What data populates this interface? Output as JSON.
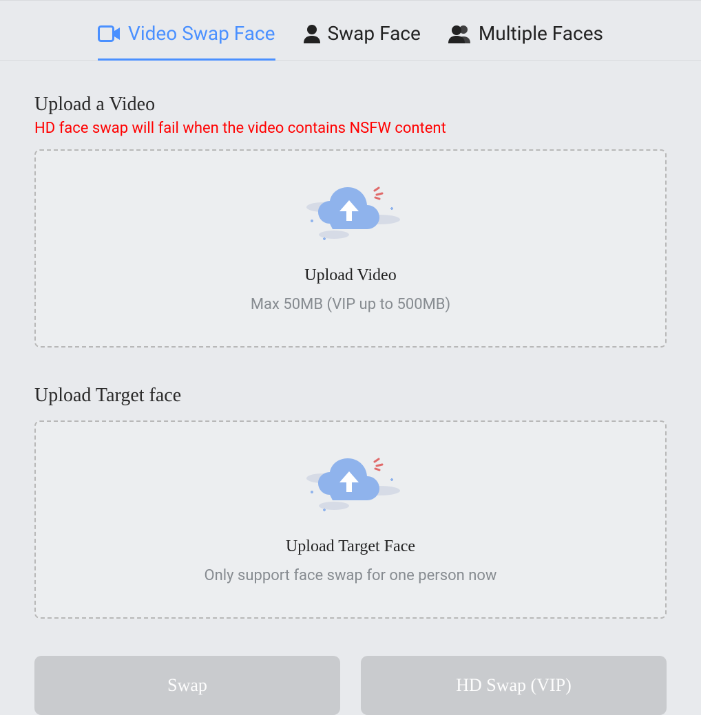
{
  "tabs": {
    "video_swap_face": "Video Swap Face",
    "swap_face": "Swap Face",
    "multiple_faces": "Multiple Faces"
  },
  "upload_video": {
    "title": "Upload a Video",
    "warning": "HD face swap will fail when the video contains NSFW content",
    "drop_title": "Upload Video",
    "drop_sub": "Max 50MB (VIP up to 500MB)"
  },
  "upload_face": {
    "title": "Upload Target face",
    "drop_title": "Upload Target Face",
    "drop_sub": "Only support face swap for one person now"
  },
  "buttons": {
    "swap": "Swap",
    "hd_swap": "HD Swap (VIP)"
  }
}
